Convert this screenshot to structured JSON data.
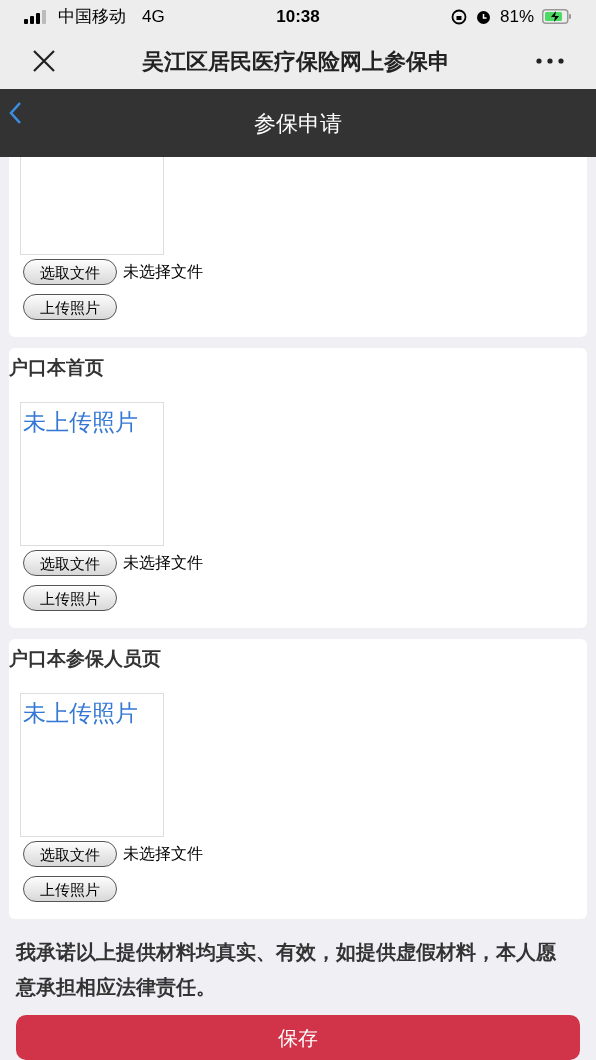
{
  "status_bar": {
    "carrier": "中国移动",
    "network": "4G",
    "time": "10:38",
    "battery": "81%"
  },
  "wechat_bar": {
    "title": "吴江区居民医疗保险网上参保申"
  },
  "header": {
    "title": "参保申请"
  },
  "uploads": [
    {
      "choose_button": "选取文件",
      "file_status": "未选择文件",
      "upload_button": "上传照片"
    },
    {
      "title": "户口本首页",
      "placeholder": "未上传照片",
      "choose_button": "选取文件",
      "file_status": "未选择文件",
      "upload_button": "上传照片"
    },
    {
      "title": "户口本参保人员页",
      "placeholder": "未上传照片",
      "choose_button": "选取文件",
      "file_status": "未选择文件",
      "upload_button": "上传照片"
    }
  ],
  "pledge": "我承诺以上提供材料均真实、有效，如提供虚假材料，本人愿意承担相应法律责任。",
  "save_button": "保存"
}
